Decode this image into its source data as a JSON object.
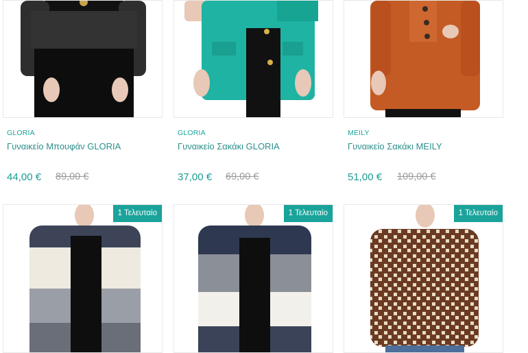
{
  "products": [
    {
      "brand": "GLORIA",
      "title": "Γυναικείο Μπουφάν GLORIA",
      "price": "44,00 €",
      "old_price": "89,00 €"
    },
    {
      "brand": "GLORIA",
      "title": "Γυναικείο Σακάκι GLORIA",
      "price": "37,00 €",
      "old_price": "69,00 €"
    },
    {
      "brand": "MEILY",
      "title": "Γυναικείο Σακάκι MEILY",
      "price": "51,00 €",
      "old_price": "109,00 €"
    },
    {
      "badge": "1 Τελευταίο"
    },
    {
      "badge": "1 Τελευταίο"
    },
    {
      "badge": "1 Τελευταίο"
    }
  ],
  "colors": {
    "accent": "#1aa39a",
    "old_price": "#9a9a9a"
  }
}
